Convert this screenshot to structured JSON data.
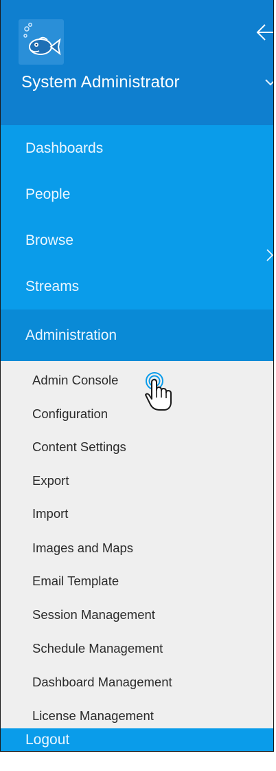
{
  "user": {
    "name": "System Administrator"
  },
  "nav": {
    "items": [
      {
        "label": "Dashboards"
      },
      {
        "label": "People"
      },
      {
        "label": "Browse"
      },
      {
        "label": "Streams"
      },
      {
        "label": "Administration"
      }
    ]
  },
  "admin_menu": {
    "items": [
      {
        "label": "Admin Console"
      },
      {
        "label": "Configuration"
      },
      {
        "label": "Content Settings"
      },
      {
        "label": "Export"
      },
      {
        "label": "Import"
      },
      {
        "label": "Images and Maps"
      },
      {
        "label": "Email Template"
      },
      {
        "label": "Session Management"
      },
      {
        "label": "Schedule Management"
      },
      {
        "label": "Dashboard Management"
      },
      {
        "label": "License Management"
      }
    ]
  },
  "footer": {
    "logout_label": "Logout"
  },
  "colors": {
    "header": "#0f7fcf",
    "nav": "#0a9cea",
    "nav_active": "#0a8ad6",
    "submenu_bg": "#efefef"
  },
  "icons": {
    "logo": "fish-logo-icon",
    "back": "arrow-left-icon",
    "user_menu": "chevron-down-icon",
    "browse": "chevron-right-icon",
    "cursor": "hand-pointer-icon"
  }
}
